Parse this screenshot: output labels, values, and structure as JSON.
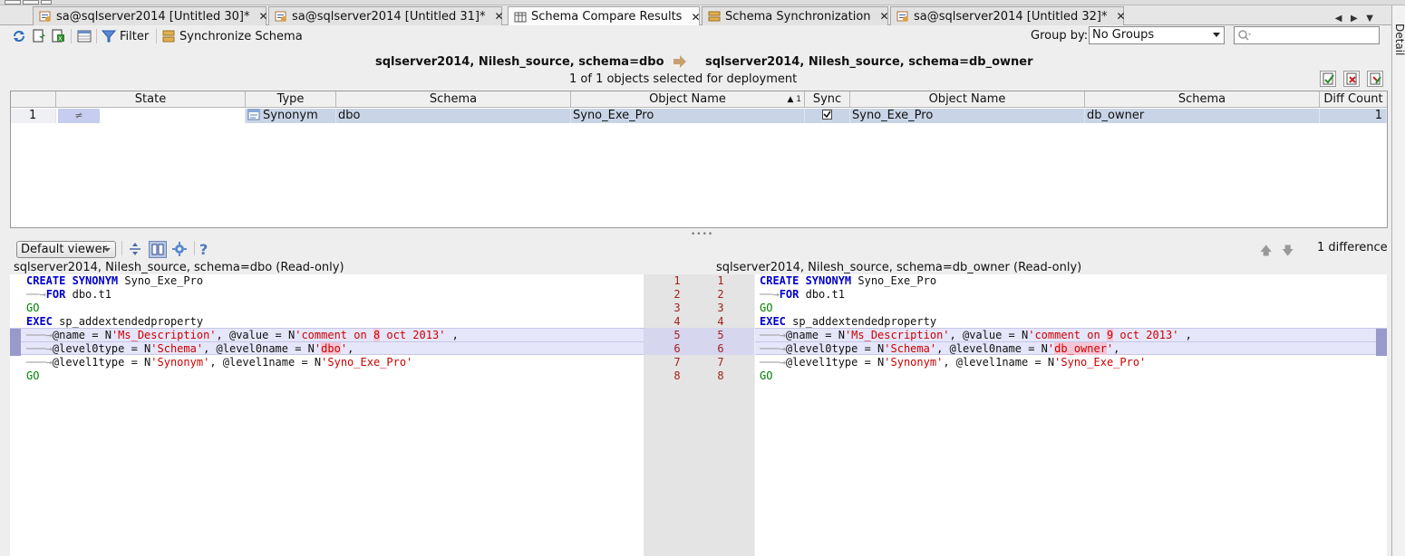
{
  "tabs": [
    {
      "label": "sa@sqlserver2014 [Untitled 30]*",
      "active": false
    },
    {
      "label": "sa@sqlserver2014 [Untitled 31]*",
      "active": false
    },
    {
      "label": "Schema Compare Results",
      "active": true
    },
    {
      "label": "Schema Synchronization",
      "active": false
    },
    {
      "label": "sa@sqlserver2014 [Untitled 32]*",
      "active": false
    }
  ],
  "side_panel_label": "Detail",
  "toolbar": {
    "filter_label": "Filter",
    "sync_label": "Synchronize Schema",
    "groupby_label": "Group by:",
    "groupby_value": "No Groups"
  },
  "compare": {
    "source": "sqlserver2014, Nilesh_source,  schema=dbo",
    "target": "sqlserver2014, Nilesh_source,  schema=db_owner",
    "selected_text": "1 of 1 objects selected for deployment"
  },
  "grid": {
    "headers": [
      "State",
      "Type",
      "Schema",
      "Object Name",
      "Sync",
      "Object Name",
      "Schema",
      "Diff Count"
    ],
    "sort_indicator": "▲ 1",
    "rows": [
      {
        "num": "1",
        "state": "≠",
        "type": "Synonym",
        "schema": "dbo",
        "object": "Syno_Exe_Pro",
        "sync": true,
        "object2": "Syno_Exe_Pro",
        "schema2": "db_owner",
        "diffcount": "1"
      }
    ]
  },
  "viewer": {
    "mode": "Default viewer",
    "difference_count": "1 difference",
    "help_label": "?"
  },
  "left_pane": {
    "title": "sqlserver2014, Nilesh_source, schema=dbo (Read-only)",
    "schema_value": "dbo",
    "date_digit": "8"
  },
  "right_pane": {
    "title": "sqlserver2014, Nilesh_source, schema=db_owner (Read-only)",
    "schema_value": "db_owner",
    "date_digit": "9"
  },
  "line_numbers": [
    "1",
    "2",
    "3",
    "4",
    "5",
    "6",
    "7",
    "8"
  ],
  "colors": {
    "keyword": "#0000cc",
    "go": "#008000",
    "string": "#cc0000",
    "diff_band": "#e6e6fa",
    "selection": "#c9d5e6"
  }
}
